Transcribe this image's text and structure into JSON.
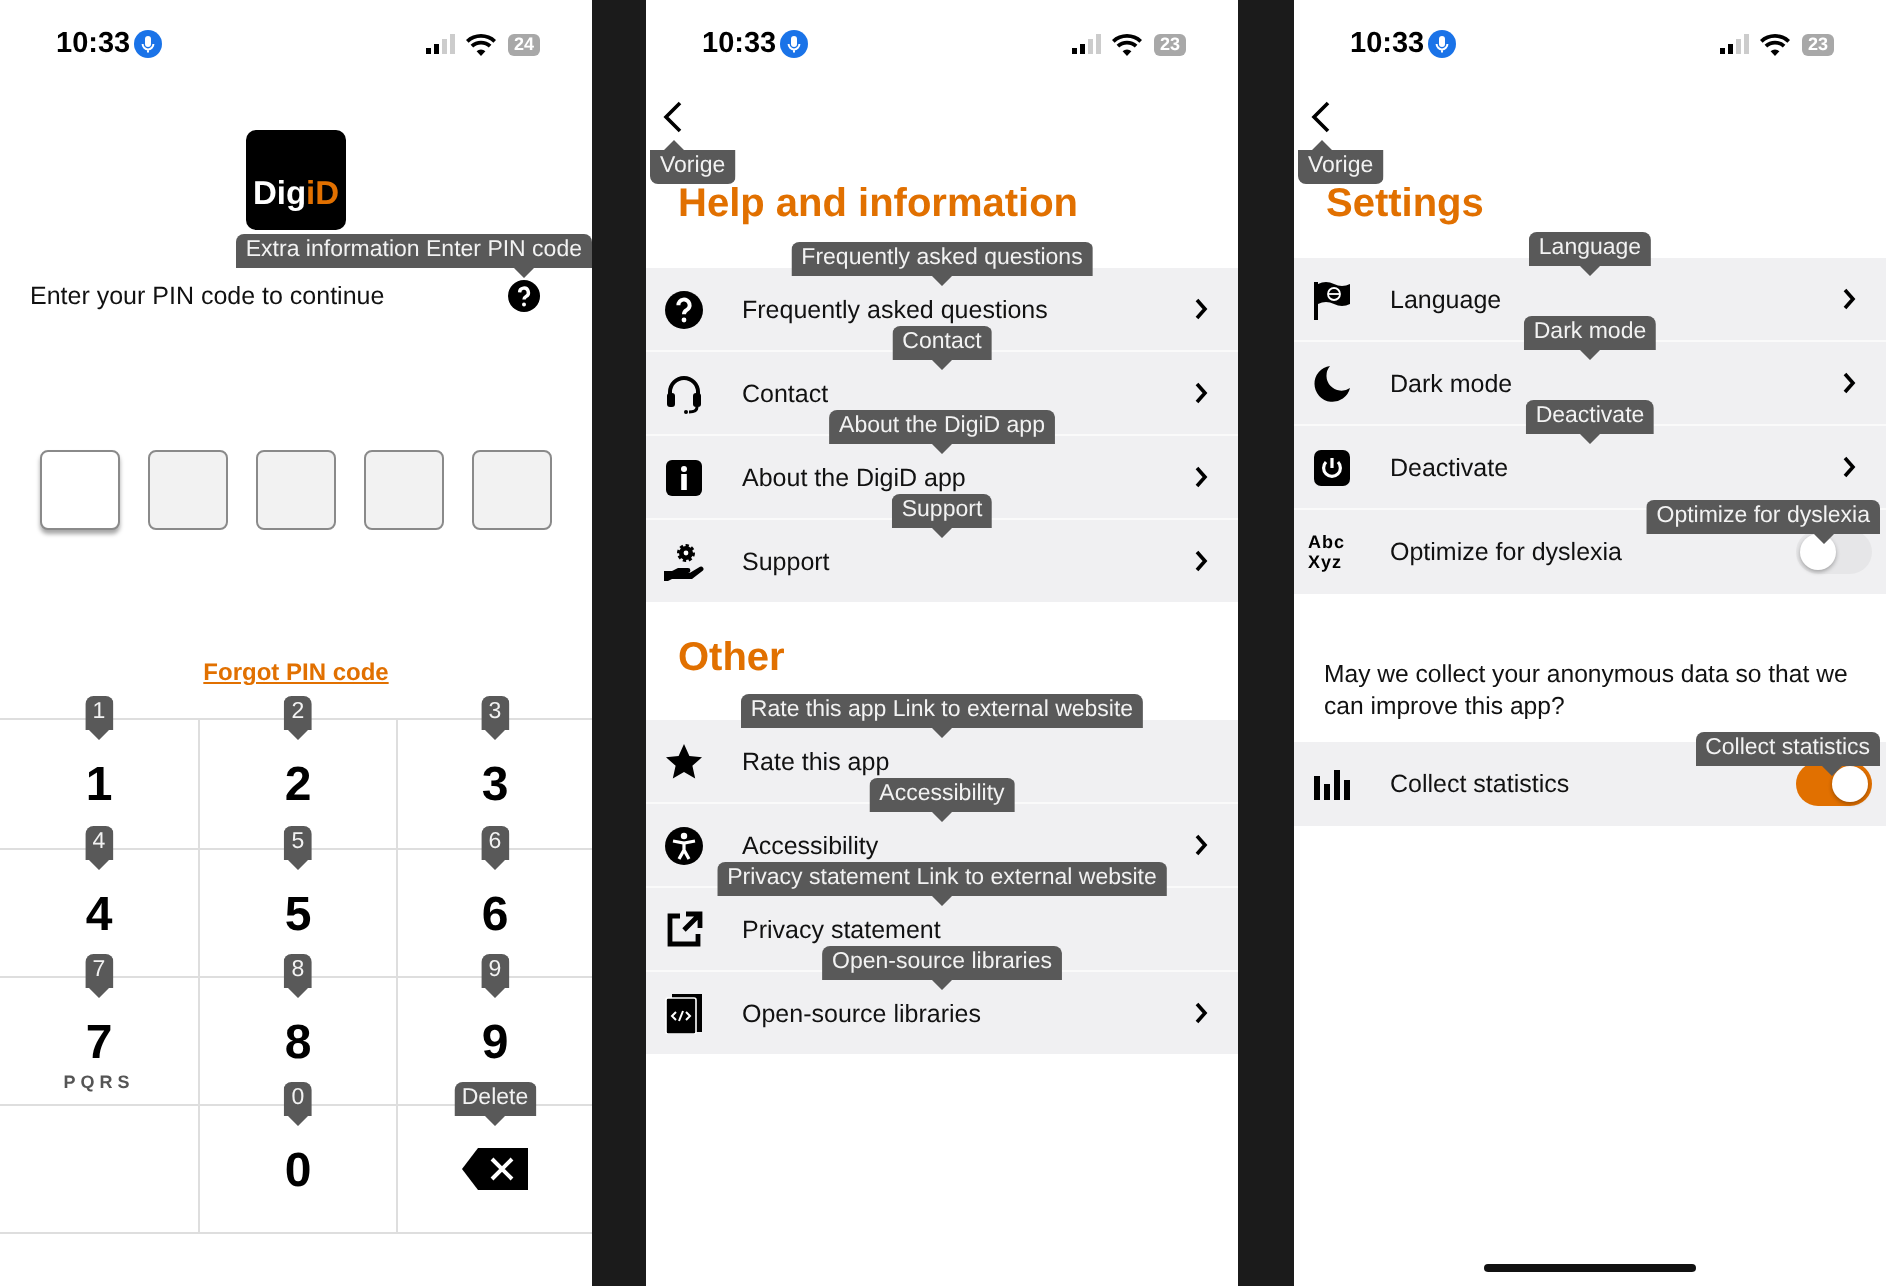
{
  "pin_screen": {
    "status_bar": {
      "time": "10:33",
      "battery": "24"
    },
    "logo": [
      "Dig",
      "iD"
    ],
    "help_tooltip": "Extra information Enter PIN code",
    "prompt": "Enter your PIN code to continue",
    "pin_boxes": [
      {
        "focused": true
      },
      {
        "focused": false
      },
      {
        "focused": false
      },
      {
        "focused": false
      },
      {
        "focused": false
      }
    ],
    "forgot_link": "Forgot PIN code",
    "keys": [
      {
        "kind": "digit",
        "digit": "1",
        "tooltip": "1"
      },
      {
        "kind": "digit",
        "digit": "2",
        "tooltip": "2"
      },
      {
        "kind": "digit",
        "digit": "3",
        "tooltip": "3"
      },
      {
        "kind": "digit",
        "digit": "4",
        "tooltip": "4"
      },
      {
        "kind": "digit",
        "digit": "5",
        "tooltip": "5"
      },
      {
        "kind": "digit",
        "digit": "6",
        "tooltip": "6"
      },
      {
        "kind": "digit",
        "digit": "7",
        "letters": "PQRS",
        "tooltip": "7"
      },
      {
        "kind": "digit",
        "digit": "8",
        "tooltip": "8"
      },
      {
        "kind": "digit",
        "digit": "9",
        "tooltip": "9"
      },
      {
        "kind": "blank"
      },
      {
        "kind": "digit",
        "digit": "0",
        "tooltip": "0"
      },
      {
        "kind": "delete",
        "tooltip": "Delete"
      }
    ]
  },
  "help_screen": {
    "status_bar": {
      "time": "10:33",
      "battery": "23"
    },
    "back_tooltip": "Vorige",
    "sections": [
      {
        "title": "Help and information",
        "rows": [
          {
            "label": "Frequently asked questions",
            "tooltip": "Frequently asked questions",
            "chevron": true
          },
          {
            "label": "Contact",
            "tooltip": "Contact",
            "chevron": true
          },
          {
            "label": "About the DigiD app",
            "tooltip": "About the DigiD app",
            "chevron": true
          },
          {
            "label": "Support",
            "tooltip": "Support",
            "chevron": true
          }
        ]
      },
      {
        "title": "Other",
        "rows": [
          {
            "label": "Rate this app",
            "tooltip": "Rate this app Link to external website",
            "chevron": false
          },
          {
            "label": "Accessibility",
            "tooltip": "Accessibility",
            "chevron": true
          },
          {
            "label": "Privacy statement",
            "tooltip": "Privacy statement Link to external website",
            "chevron": false
          },
          {
            "label": "Open-source libraries",
            "tooltip": "Open-source libraries",
            "chevron": true
          }
        ]
      }
    ]
  },
  "settings_screen": {
    "status_bar": {
      "time": "10:33",
      "battery": "23"
    },
    "back_tooltip": "Vorige",
    "title": "Settings",
    "rows": [
      {
        "kind": "nav",
        "label": "Language",
        "tooltip": "Language"
      },
      {
        "kind": "nav",
        "label": "Dark mode",
        "tooltip": "Dark mode"
      },
      {
        "kind": "nav",
        "label": "Deactivate",
        "tooltip": "Deactivate"
      },
      {
        "kind": "toggle",
        "icon_text": "Abc\nXyz",
        "label": "Optimize for dyslexia",
        "tooltip": "Optimize for dyslexia",
        "on": false
      }
    ],
    "statistics_question": "May we collect your anonymous data so that we can improve this app?",
    "statistics_row": {
      "kind": "toggle",
      "label": "Collect statistics",
      "tooltip": "Collect statistics",
      "on": true
    }
  }
}
